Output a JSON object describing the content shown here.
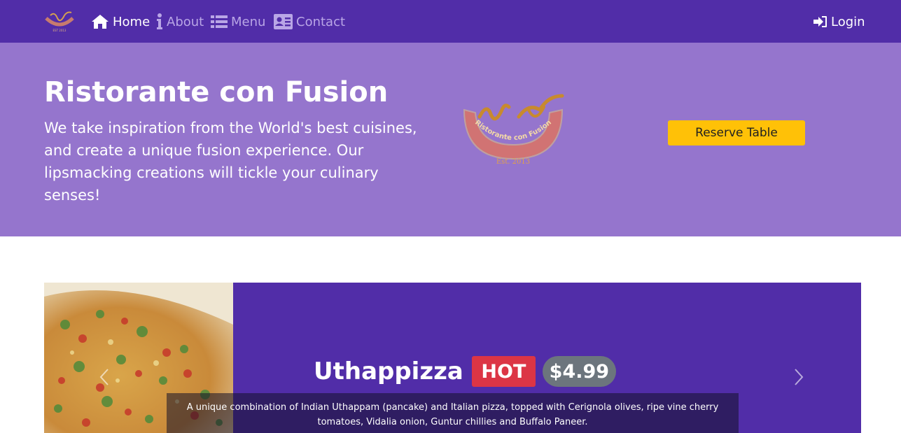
{
  "nav": {
    "brand_alt": "Ristorante con Fusion",
    "items": [
      {
        "label": "Home",
        "icon": "home-icon",
        "active": true
      },
      {
        "label": "About",
        "icon": "info-icon",
        "active": false
      },
      {
        "label": "Menu",
        "icon": "list-icon",
        "active": false
      },
      {
        "label": "Contact",
        "icon": "address-card-icon",
        "active": false
      }
    ],
    "login_label": "Login",
    "login_icon": "sign-in-icon"
  },
  "jumbotron": {
    "title": "Ristorante con Fusion",
    "text": "We take inspiration from the World's best cuisines, and create a unique fusion experience. Our lipsmacking creations will tickle your culinary senses!",
    "logo_text": "Ristorante con Fusion",
    "logo_est": "Est. 2013",
    "reserve_label": "Reserve Table"
  },
  "carousel": {
    "dish_name": "Uthappizza",
    "badge": "HOT",
    "price": "$4.99",
    "description": "A unique combination of Indian Uthappam (pancake) and Italian pizza, topped with Cerignola olives, ripe vine cherry tomatoes, Vidalia onion, Guntur chillies and Buffalo Paneer.",
    "prev_icon": "chevron-left-icon",
    "next_icon": "chevron-right-icon"
  },
  "colors": {
    "navbar": "#512da8",
    "jumbotron": "#9575cd",
    "accent": "#ffc107",
    "hot_badge": "#dc3545",
    "price_badge": "#6c757d"
  }
}
